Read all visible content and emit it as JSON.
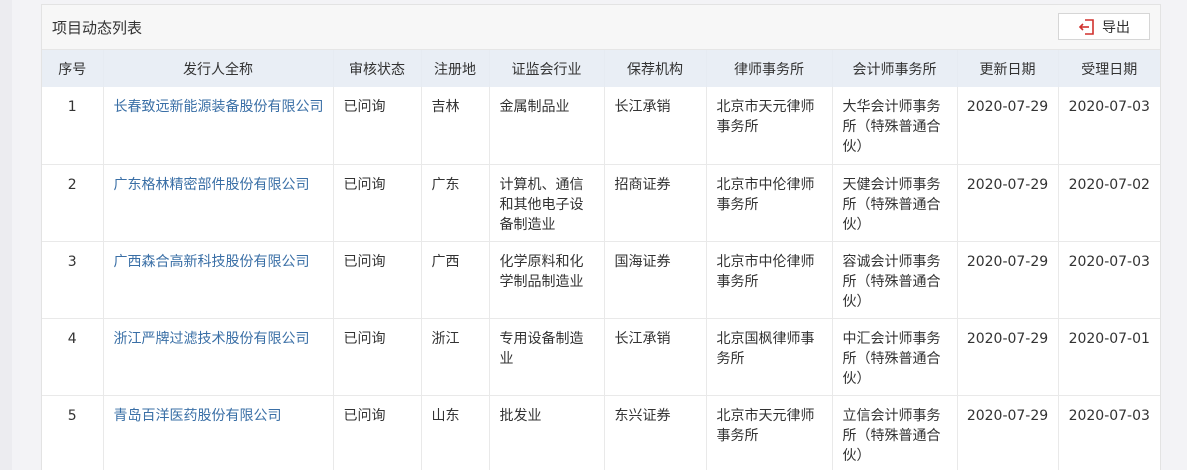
{
  "panel": {
    "title": "项目动态列表",
    "export_label": "导出"
  },
  "table": {
    "headers": [
      "序号",
      "发行人全称",
      "审核状态",
      "注册地",
      "证监会行业",
      "保荐机构",
      "律师事务所",
      "会计师事务所",
      "更新日期",
      "受理日期"
    ],
    "rows": [
      [
        "1",
        "长春致远新能源装备股份有限公司",
        "已问询",
        "吉林",
        "金属制品业",
        "长江承销",
        "北京市天元律师事务所",
        "大华会计师事务所（特殊普通合伙）",
        "2020-07-29",
        "2020-07-03"
      ],
      [
        "2",
        "广东格林精密部件股份有限公司",
        "已问询",
        "广东",
        "计算机、通信和其他电子设备制造业",
        "招商证券",
        "北京市中伦律师事务所",
        "天健会计师事务所（特殊普通合伙）",
        "2020-07-29",
        "2020-07-02"
      ],
      [
        "3",
        "广西森合高新科技股份有限公司",
        "已问询",
        "广西",
        "化学原料和化学制品制造业",
        "国海证券",
        "北京市中伦律师事务所",
        "容诚会计师事务所（特殊普通合伙）",
        "2020-07-29",
        "2020-07-03"
      ],
      [
        "4",
        "浙江严牌过滤技术股份有限公司",
        "已问询",
        "浙江",
        "专用设备制造业",
        "长江承销",
        "北京国枫律师事务所",
        "中汇会计师事务所（特殊普通合伙）",
        "2020-07-29",
        "2020-07-01"
      ],
      [
        "5",
        "青岛百洋医药股份有限公司",
        "已问询",
        "山东",
        "批发业",
        "东兴证券",
        "北京市天元律师事务所",
        "立信会计师事务所（特殊普通合伙）",
        "2020-07-29",
        "2020-07-03"
      ]
    ]
  },
  "colors": {
    "link": "#3a6fa6",
    "header_bg": "#e9eef5",
    "export_icon": "#d0312d"
  },
  "icons": {
    "export": "export-icon"
  }
}
